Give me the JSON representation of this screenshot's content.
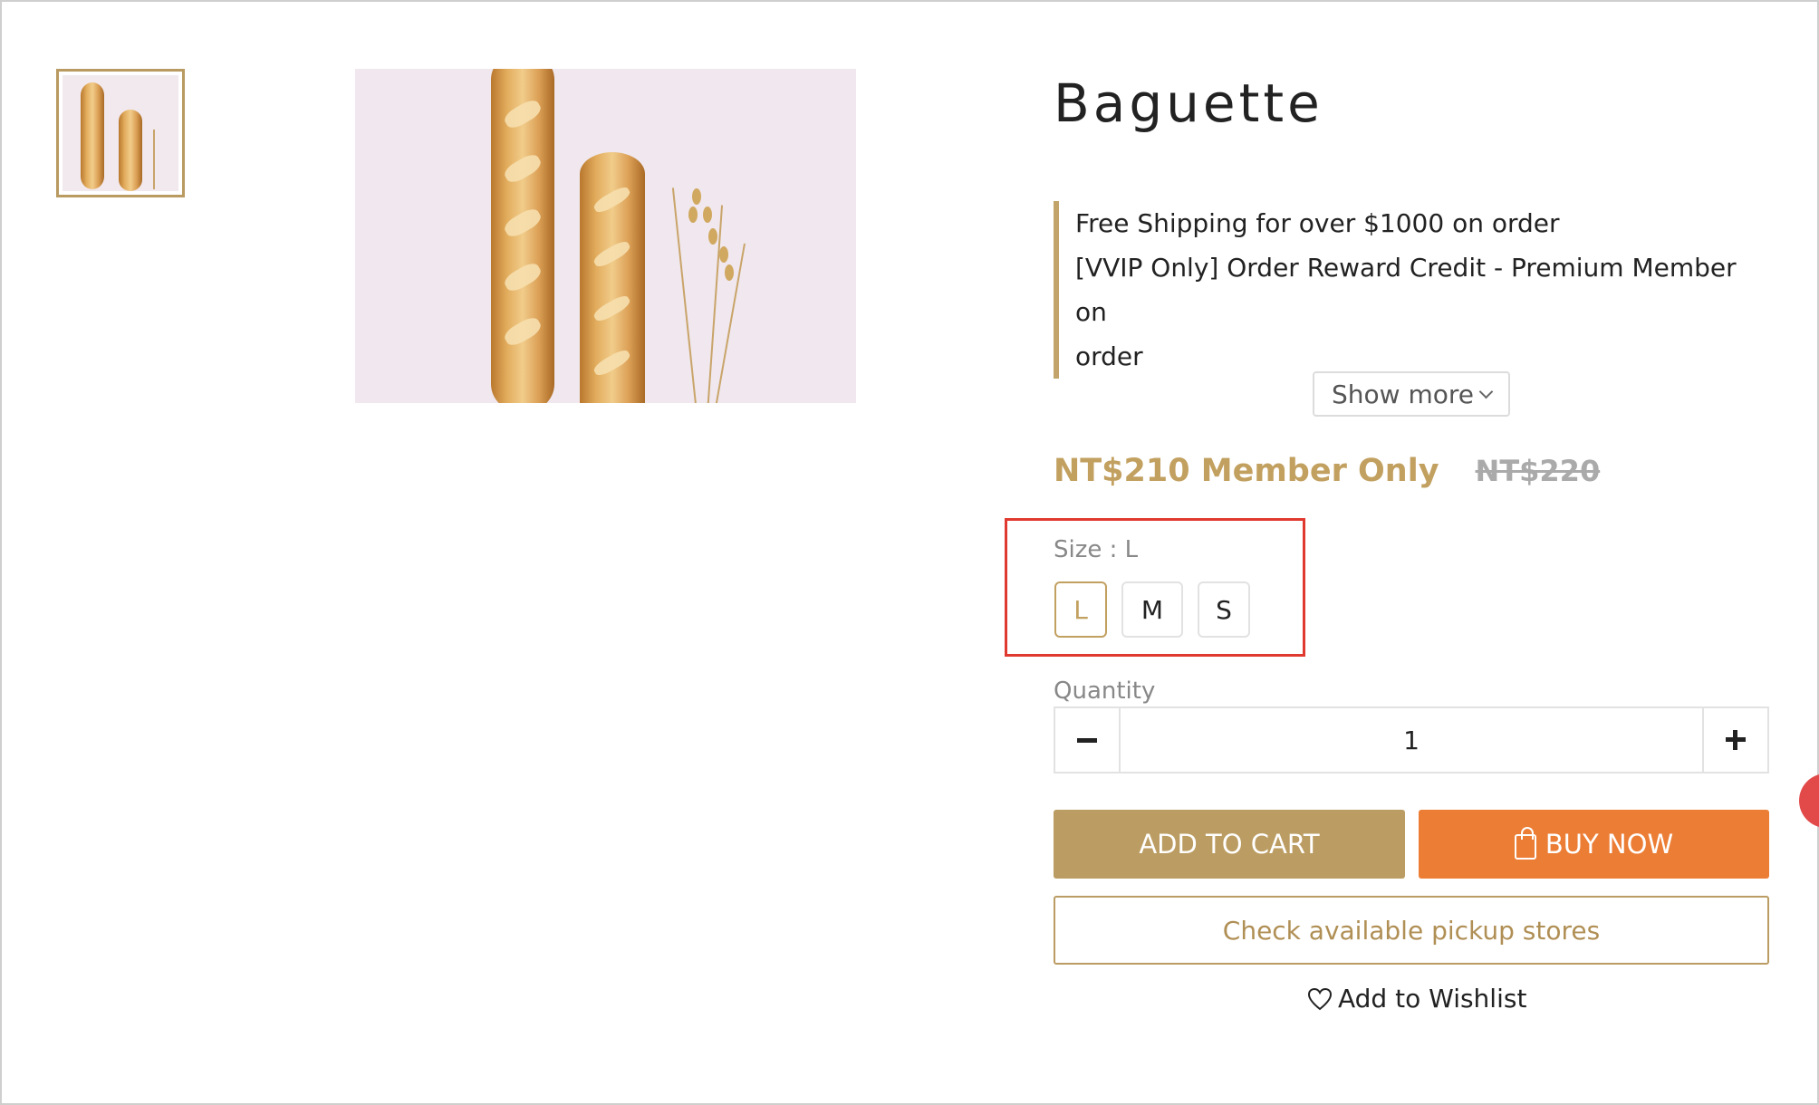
{
  "product": {
    "title": "Baguette",
    "promotions": [
      "Free Shipping for over $1000 on order",
      "[VVIP Only] Order Reward Credit - Premium Member on",
      "order"
    ],
    "show_more_label": "Show more",
    "price_member": "NT$210 Member Only",
    "price_original": "NT$220"
  },
  "size": {
    "label": "Size : L",
    "options": [
      "L",
      "M",
      "S"
    ],
    "selected": "L"
  },
  "quantity": {
    "label": "Quantity",
    "value": "1"
  },
  "actions": {
    "add_to_cart": "ADD TO CART",
    "buy_now": "BUY NOW",
    "pickup": "Check available pickup stores",
    "wishlist": "Add to Wishlist"
  },
  "colors": {
    "accent_gold": "#bb9c62",
    "buy_orange": "#ec7d35",
    "highlight_red": "#e0392f"
  },
  "icons": [
    "chevron-down-icon",
    "minus-icon",
    "plus-icon",
    "shopping-bag-icon",
    "heart-icon"
  ]
}
